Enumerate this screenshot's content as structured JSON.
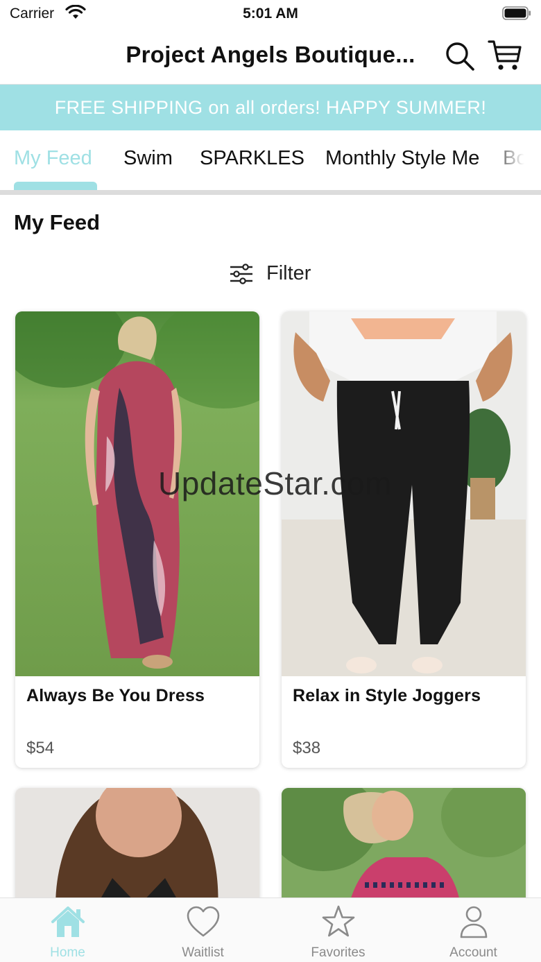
{
  "status_bar": {
    "carrier": "Carrier",
    "time": "5:01 AM",
    "icons": [
      "wifi-icon",
      "battery-icon"
    ]
  },
  "header": {
    "title": "Project Angels Boutique...",
    "icons": [
      "search-icon",
      "cart-icon"
    ]
  },
  "promo_banner": {
    "text": "FREE SHIPPING on all orders! HAPPY SUMMER!",
    "background_color": "#9fe0e4"
  },
  "category_tabs": [
    {
      "label": "My Feed",
      "active": true
    },
    {
      "label": "Swim",
      "active": false
    },
    {
      "label": "SPARKLES",
      "active": false
    },
    {
      "label": "Monthly Style Me",
      "active": false
    },
    {
      "label": "Bo",
      "active": false
    }
  ],
  "feed": {
    "title": "My Feed",
    "filter_label": "Filter"
  },
  "products": [
    {
      "name": "Always Be You Dress",
      "price": "$54"
    },
    {
      "name": "Relax in Style Joggers",
      "price": "$38"
    }
  ],
  "watermark": "UpdateStar.com",
  "bottom_tabs": [
    {
      "label": "Home",
      "icon": "home-icon",
      "active": true
    },
    {
      "label": "Waitlist",
      "icon": "heart-icon",
      "active": false
    },
    {
      "label": "Favorites",
      "icon": "star-icon",
      "active": false
    },
    {
      "label": "Account",
      "icon": "account-icon",
      "active": false
    }
  ],
  "colors": {
    "accent": "#9fe0e4",
    "text": "#111111",
    "muted": "#8a8a8a"
  }
}
